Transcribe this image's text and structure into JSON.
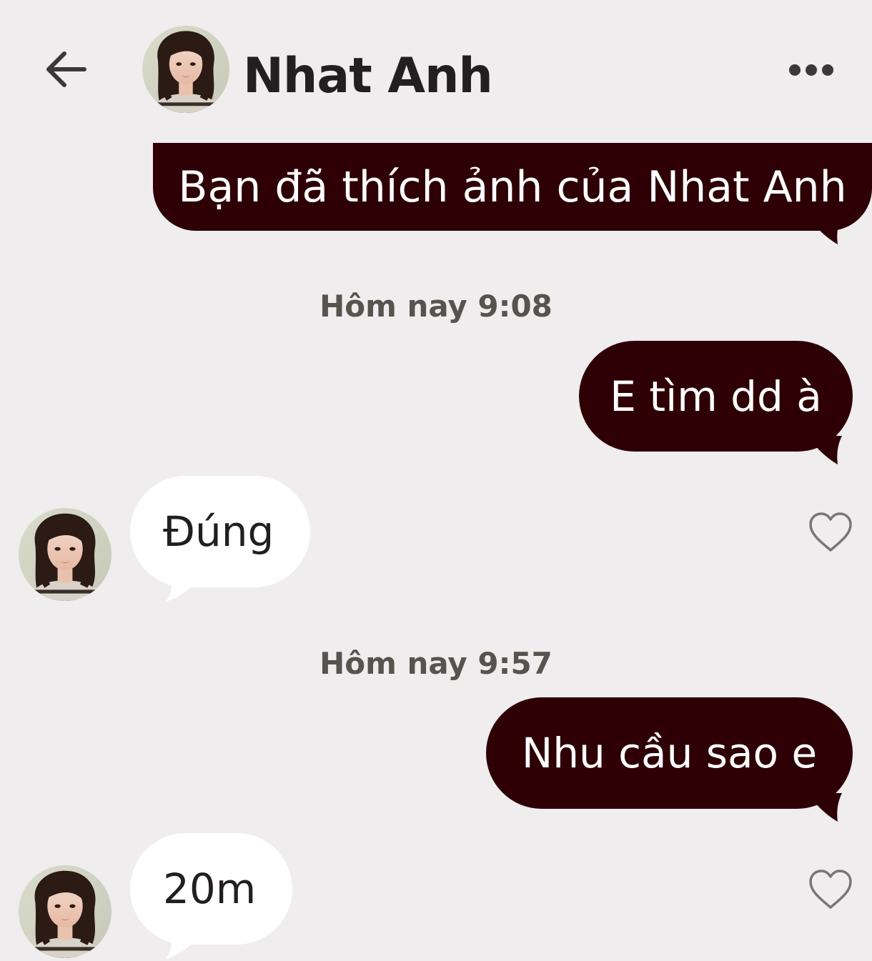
{
  "header": {
    "contact_name": "Nhat Anh",
    "back_icon": "arrow-left-icon",
    "more_icon": "more-horizontal-icon"
  },
  "messages": [
    {
      "type": "sent",
      "text": "Bạn đã thích ảnh của Nhat Anh"
    },
    {
      "type": "timestamp",
      "text": "Hôm nay 9:08"
    },
    {
      "type": "sent",
      "text": "E tìm dd à"
    },
    {
      "type": "received",
      "text": "Đúng",
      "like_icon": "heart-outline-icon"
    },
    {
      "type": "timestamp",
      "text": "Hôm nay 9:57"
    },
    {
      "type": "sent",
      "text": "Nhu cầu sao e"
    },
    {
      "type": "received",
      "text": "20m",
      "like_icon": "heart-outline-icon"
    }
  ],
  "colors": {
    "background": "#efedee",
    "sent_bubble": "#2e0006",
    "received_bubble": "#ffffff",
    "text_dark": "#221f20",
    "timestamp": "#57534f"
  }
}
